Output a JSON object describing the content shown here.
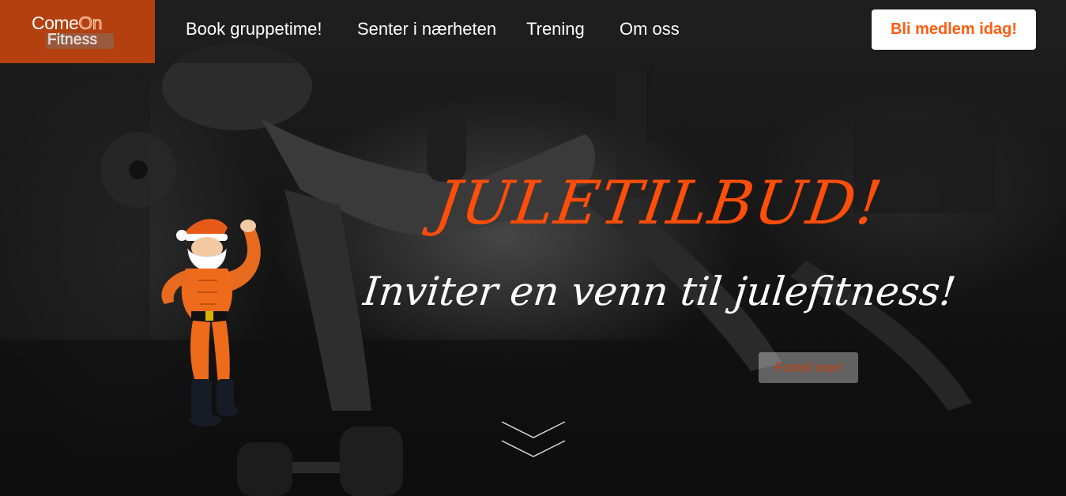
{
  "logo": {
    "come": "Come",
    "on": "On",
    "fitness": "Fitness"
  },
  "nav": {
    "items": [
      {
        "label": "Book gruppetime!"
      },
      {
        "label": "Senter i nærheten"
      },
      {
        "label": "Trening"
      },
      {
        "label": "Om oss"
      }
    ]
  },
  "cta": {
    "label": "Bli medlem idag!"
  },
  "hero": {
    "headline": "JULETILBUD!",
    "subheadline": "Inviter en venn til julefitness!",
    "button_label": "Fortell mer!"
  },
  "colors": {
    "brand": "#b3400e",
    "accent": "#ff4d0a",
    "cta_text": "#ff5c0f"
  },
  "icons": {
    "scroll": "chevron-double-down-icon",
    "santa": "santa-illustration"
  }
}
